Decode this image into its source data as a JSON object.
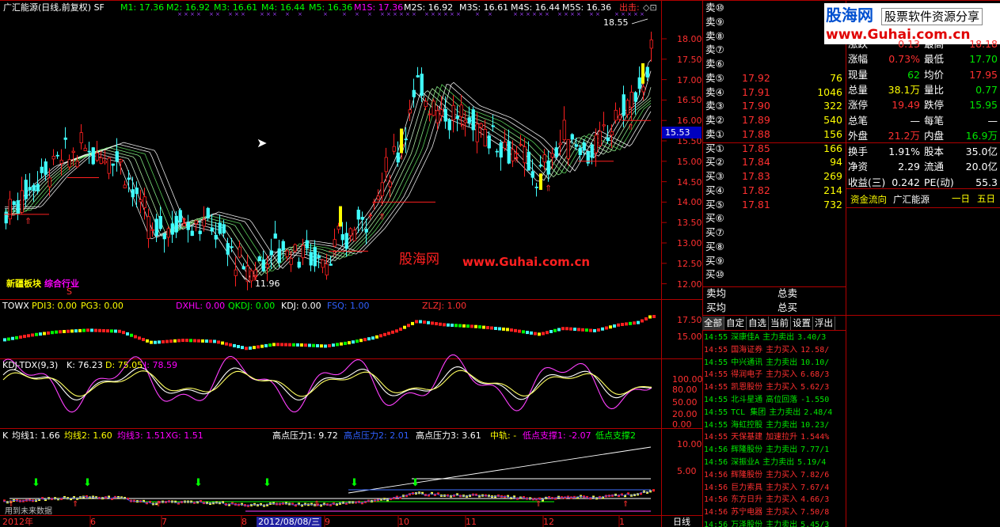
{
  "main_header": {
    "title": "广汇能源(日线,前复权) SF",
    "ma": [
      {
        "label": "M1: 17.36",
        "color": "#00ff00"
      },
      {
        "label": "M2: 16.92",
        "color": "#00ff00"
      },
      {
        "label": "M3: 16.61",
        "color": "#00ff00"
      },
      {
        "label": "M4: 16.44",
        "color": "#00ff00"
      },
      {
        "label": "M5: 16.36",
        "color": "#00ff00"
      },
      {
        "label": "M1S: 17.36",
        "color": "#ff00ff"
      },
      {
        "label": "M2S: 16.92",
        "color": "#ffffff"
      },
      {
        "label": "M3S: 16.61",
        "color": "#ffffff"
      },
      {
        "label": "M4S: 16.44",
        "color": "#ffffff"
      },
      {
        "label": "M5S: 16.36",
        "color": "#ffffff"
      }
    ],
    "exit_label": "出击:"
  },
  "main_chart": {
    "y_ticks": [
      "18.00",
      "17.50",
      "17.00",
      "16.50",
      "16.00",
      "15.50",
      "15.00",
      "14.50",
      "14.00",
      "13.50",
      "13.00",
      "12.50",
      "12.00"
    ],
    "price_tag": "15.53",
    "high_annot": "18.55",
    "low_annot": "11.96",
    "sector_label_a": "新疆板块",
    "sector_label_b": "综合行业",
    "watermark_cn": "股海网",
    "watermark_url": "www.Guhai.com.cn",
    "marker_s": "S"
  },
  "panel1": {
    "labels": [
      {
        "text": "TOWX",
        "color": "#ffffff"
      },
      {
        "text": "PDI3: 0.00",
        "color": "#ffff00"
      },
      {
        "text": "PG3: 0.00",
        "color": "#ffff00"
      },
      {
        "text": "DXHL: 0.00",
        "color": "#ff00ff"
      },
      {
        "text": "QKDJ: 0.00",
        "color": "#00ff00"
      },
      {
        "text": "KDJ: 0.00",
        "color": "#ffffff"
      },
      {
        "text": "FSQ: 1.00",
        "color": "#3060ff"
      },
      {
        "text": "ZLZJ: 1.00",
        "color": "#ff3030"
      }
    ],
    "y_ticks": [
      "17.50",
      "15.00"
    ]
  },
  "panel2": {
    "labels": [
      {
        "text": "KDJ-TDX(9,3)",
        "color": "#ffffff"
      },
      {
        "text": "K: 76.23",
        "color": "#ffffff"
      },
      {
        "text": "D: 75.05",
        "color": "#ffff00"
      },
      {
        "text": "J: 78.59",
        "color": "#ff00ff"
      }
    ],
    "y_ticks": [
      "100.00",
      "80.00",
      "50.00",
      "20.00",
      "0.00"
    ]
  },
  "panel3": {
    "labels": [
      {
        "text": "K",
        "color": "#ffffff"
      },
      {
        "text": "均线1: 1.66",
        "color": "#ffffff"
      },
      {
        "text": "均线2: 1.60",
        "color": "#ffff00"
      },
      {
        "text": "均线3: 1.51",
        "color": "#ff00ff"
      },
      {
        "text": "XG: 1.51",
        "color": "#ff00ff"
      },
      {
        "text": "高点压力1: 9.72",
        "color": "#ffffff"
      },
      {
        "text": "高点压力2: 2.01",
        "color": "#3060ff"
      },
      {
        "text": "高点压力3: 3.61",
        "color": "#ffffff"
      },
      {
        "text": "中轨: -",
        "color": "#ffff00"
      },
      {
        "text": "低点支撑1: -2.07",
        "color": "#ff00ff"
      },
      {
        "text": "低点支撑2",
        "color": "#00ff00"
      }
    ],
    "y_ticks": [
      "10.00",
      "5.00"
    ],
    "footer_note": "用到未来数据"
  },
  "x_axis": {
    "labels": [
      "2012年",
      "6",
      "7",
      "8",
      "2012/08/08/三",
      "9",
      "10",
      "11",
      "12",
      "1"
    ],
    "period": "日线"
  },
  "order_book": {
    "sells": [
      {
        "label": "卖⑩",
        "price": "",
        "vol": ""
      },
      {
        "label": "卖⑨",
        "price": "",
        "vol": ""
      },
      {
        "label": "卖⑧",
        "price": "",
        "vol": ""
      },
      {
        "label": "卖⑦",
        "price": "",
        "vol": ""
      },
      {
        "label": "卖⑥",
        "price": "",
        "vol": ""
      },
      {
        "label": "卖⑤",
        "price": "17.92",
        "vol": "76"
      },
      {
        "label": "卖④",
        "price": "17.91",
        "vol": "1046"
      },
      {
        "label": "卖③",
        "price": "17.90",
        "vol": "322"
      },
      {
        "label": "卖②",
        "price": "17.89",
        "vol": "540"
      },
      {
        "label": "卖①",
        "price": "17.88",
        "vol": "156"
      }
    ],
    "buys": [
      {
        "label": "买①",
        "price": "17.85",
        "vol": "166"
      },
      {
        "label": "买②",
        "price": "17.84",
        "vol": "94"
      },
      {
        "label": "买③",
        "price": "17.83",
        "vol": "269"
      },
      {
        "label": "买④",
        "price": "17.82",
        "vol": "214"
      },
      {
        "label": "买⑤",
        "price": "17.81",
        "vol": "732"
      },
      {
        "label": "买⑥",
        "price": "",
        "vol": ""
      },
      {
        "label": "买⑦",
        "price": "",
        "vol": ""
      },
      {
        "label": "买⑧",
        "price": "",
        "vol": ""
      },
      {
        "label": "买⑨",
        "price": "",
        "vol": ""
      },
      {
        "label": "买⑩",
        "price": "",
        "vol": ""
      }
    ],
    "avg_sell": "卖均",
    "total_sell": "总卖",
    "avg_buy": "买均",
    "total_buy": "总买"
  },
  "logo": {
    "brand": "股海网",
    "slogan": "股票软件资源分享",
    "url": "www.Guhai.com.cn"
  },
  "quote": {
    "rows": [
      {
        "l1": "涨跌",
        "v1": "0.13",
        "c1": "#ff3030",
        "l2": "最高",
        "v2": "18.18",
        "c2": "#ff3030"
      },
      {
        "l1": "涨幅",
        "v1": "0.73%",
        "c1": "#ff3030",
        "l2": "最低",
        "v2": "17.70",
        "c2": "#00e600"
      },
      {
        "l1": "现量",
        "v1": "62",
        "c1": "#00e600",
        "l2": "均价",
        "v2": "17.95",
        "c2": "#ff3030"
      },
      {
        "l1": "总量",
        "v1": "38.1万",
        "c1": "#ffff00",
        "l2": "量比",
        "v2": "0.77",
        "c2": "#00e600"
      },
      {
        "l1": "涨停",
        "v1": "19.49",
        "c1": "#ff3030",
        "l2": "跌停",
        "v2": "15.95",
        "c2": "#00e600"
      },
      {
        "l1": "总笔",
        "v1": "—",
        "c1": "#ffffff",
        "l2": "每笔",
        "v2": "—",
        "c2": "#ffffff"
      },
      {
        "l1": "外盘",
        "v1": "21.2万",
        "c1": "#ff3030",
        "l2": "内盘",
        "v2": "16.9万",
        "c2": "#00e600"
      },
      {
        "l1": "换手",
        "v1": "1.91%",
        "c1": "#ffffff",
        "l2": "股本",
        "v2": "35.0亿",
        "c2": "#ffffff"
      },
      {
        "l1": "净资",
        "v1": "2.29",
        "c1": "#ffffff",
        "l2": "流通",
        "v2": "20.0亿",
        "c2": "#ffffff"
      },
      {
        "l1": "收益(三)",
        "v1": "0.242",
        "c1": "#ffffff",
        "l2": "PE(动)",
        "v2": "55.3",
        "c2": "#ffffff"
      }
    ]
  },
  "fund_flow": {
    "title": "资金流向",
    "stock": "广汇能源",
    "btn_day1": "一日",
    "btn_day5": "五日"
  },
  "tabs": [
    "全部",
    "自定",
    "自选",
    "当前",
    "设置",
    "浮出"
  ],
  "flow_list": [
    {
      "time": "14:55",
      "name": "深康佳A",
      "action": "主力卖出",
      "val": "3.40/3",
      "color": "#00e600"
    },
    {
      "time": "14:55",
      "name": "国海证券",
      "action": "主力买入",
      "val": "12.58/",
      "color": "#ff3030"
    },
    {
      "time": "14:55",
      "name": "中兴通讯",
      "action": "主力卖出",
      "val": "10.10/",
      "color": "#00e600"
    },
    {
      "time": "14:55",
      "name": "得润电子",
      "action": "主力买入",
      "val": "6.68/3",
      "color": "#ff3030"
    },
    {
      "time": "14:55",
      "name": "凯恩股份",
      "action": "主力买入",
      "val": "5.62/3",
      "color": "#ff3030"
    },
    {
      "time": "14:55",
      "name": "北斗星通",
      "action": "高位回落",
      "val": "-1.550",
      "color": "#00e600"
    },
    {
      "time": "14:55",
      "name": "TCL 集团",
      "action": "主力卖出",
      "val": "2.48/4",
      "color": "#00e600"
    },
    {
      "time": "14:55",
      "name": "海虹控股",
      "action": "主力卖出",
      "val": "10.23/",
      "color": "#00e600"
    },
    {
      "time": "14:55",
      "name": "天保基建",
      "action": "加速拉升",
      "val": "1.544%",
      "color": "#ff3030"
    },
    {
      "time": "14:56",
      "name": "辉隆股份",
      "action": "主力卖出",
      "val": "7.77/1",
      "color": "#00e600"
    },
    {
      "time": "14:56",
      "name": "深振业A",
      "action": "主力卖出",
      "val": "5.19/4",
      "color": "#00e600"
    },
    {
      "time": "14:56",
      "name": "辉隆股份",
      "action": "主力买入",
      "val": "7.82/6",
      "color": "#ff3030"
    },
    {
      "time": "14:56",
      "name": "巨力索具",
      "action": "主力买入",
      "val": "7.67/4",
      "color": "#ff3030"
    },
    {
      "time": "14:56",
      "name": "东方日升",
      "action": "主力买入",
      "val": "4.66/3",
      "color": "#ff3030"
    },
    {
      "time": "14:56",
      "name": "苏宁电器",
      "action": "主力买入",
      "val": "7.50/8",
      "color": "#ff3030"
    },
    {
      "time": "14:56",
      "name": "万泽股份",
      "action": "主力卖出",
      "val": "5.45/3",
      "color": "#00e600"
    }
  ],
  "colors": {
    "up": "#ff3030",
    "down": "#00ffff",
    "grid": "#8b0000",
    "axis": "#ff3030"
  }
}
